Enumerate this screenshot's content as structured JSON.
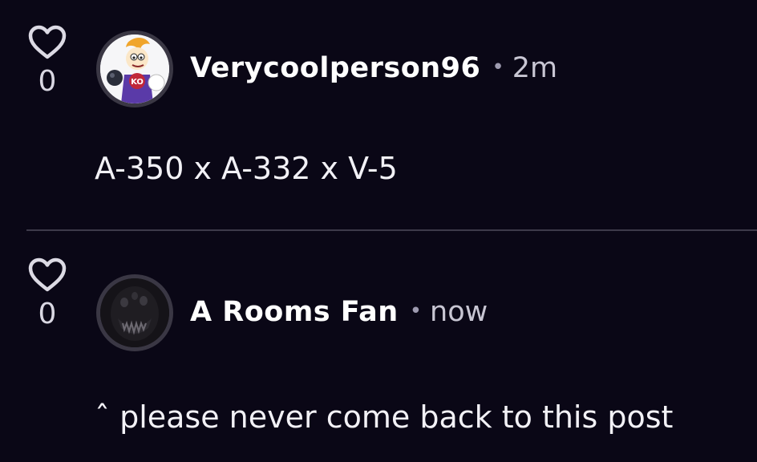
{
  "comments": [
    {
      "likes": "0",
      "username": "Verycoolperson96",
      "separator": "•",
      "time": "2m",
      "text": "A-350 x A-332 x V-5"
    },
    {
      "likes": "0",
      "username": "A Rooms Fan",
      "separator": "•",
      "time": "now",
      "text": "ˆ please never come back to this post"
    }
  ],
  "icons": {
    "like": "heart-outline-icon"
  },
  "colors": {
    "background": "#0a0716",
    "divider": "#3d3a4a",
    "muted_text": "#c8c6d3"
  }
}
